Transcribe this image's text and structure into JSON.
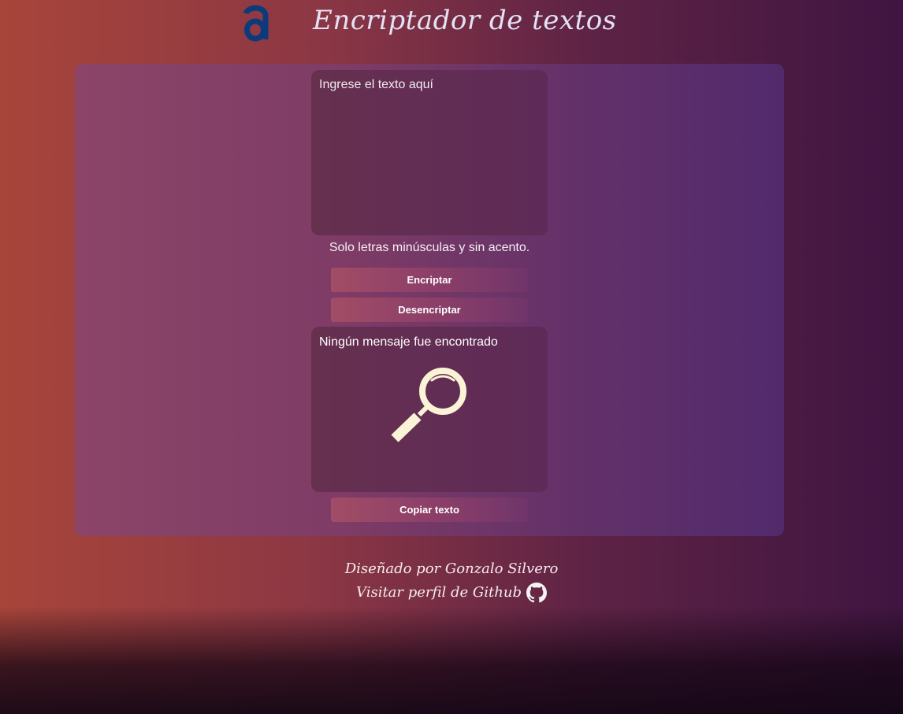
{
  "header": {
    "title": "Encriptador de textos",
    "logo_icon": "alura-logo-icon"
  },
  "encrypt_form": {
    "input_placeholder": "Ingrese el texto aquí",
    "input_value": "",
    "hint": "Solo letras minúsculas y sin acento.",
    "encrypt_label": "Encriptar",
    "decrypt_label": "Desencriptar"
  },
  "output": {
    "empty_message": "Ningún mensaje fue encontrado",
    "empty_icon": "magnifier-icon",
    "copy_label": "Copiar texto"
  },
  "footer": {
    "credit": "Diseñado por Gonzalo Silvero",
    "github_link": "Visitar perfil de Github",
    "github_icon": "github-icon"
  },
  "colors": {
    "title": "#e4e2f6",
    "logo": "#0b3b7a",
    "magnifier": "#fbf3d6",
    "panel": "#7d3b66",
    "box": "#5e2b58"
  }
}
